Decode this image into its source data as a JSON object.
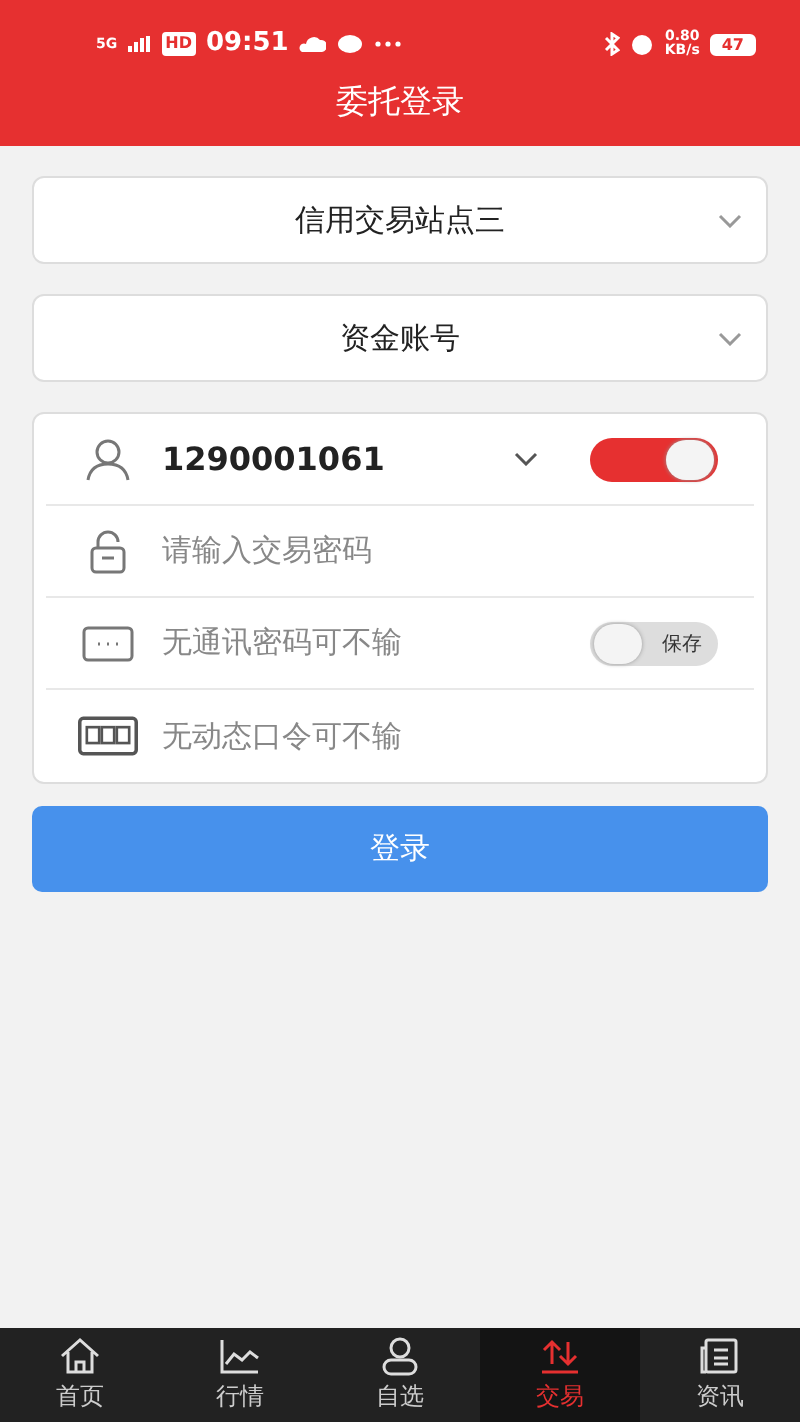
{
  "status_bar": {
    "network": "5G",
    "hd": "HD",
    "time": "09:51",
    "speed": "0.80",
    "speed_unit": "KB/s",
    "battery": "47"
  },
  "header": {
    "title": "委托登录"
  },
  "selectors": [
    {
      "value": "信用交易站点三"
    },
    {
      "value": "资金账号"
    }
  ],
  "form_rows": [
    {
      "kind": "account",
      "value": "1290001061",
      "toggle_on": true
    },
    {
      "kind": "password",
      "placeholder": "请输入交易密码"
    },
    {
      "kind": "comm",
      "placeholder": "无通讯密码可不输",
      "toggle_on": false,
      "toggle_label": "保存"
    },
    {
      "kind": "otp",
      "placeholder": "无动态口令可不输"
    }
  ],
  "login_button": "登录",
  "tabs": [
    {
      "label": "首页",
      "selected": false
    },
    {
      "label": "行情",
      "selected": false
    },
    {
      "label": "自选",
      "selected": false
    },
    {
      "label": "交易",
      "selected": true
    },
    {
      "label": "资讯",
      "selected": false
    }
  ]
}
